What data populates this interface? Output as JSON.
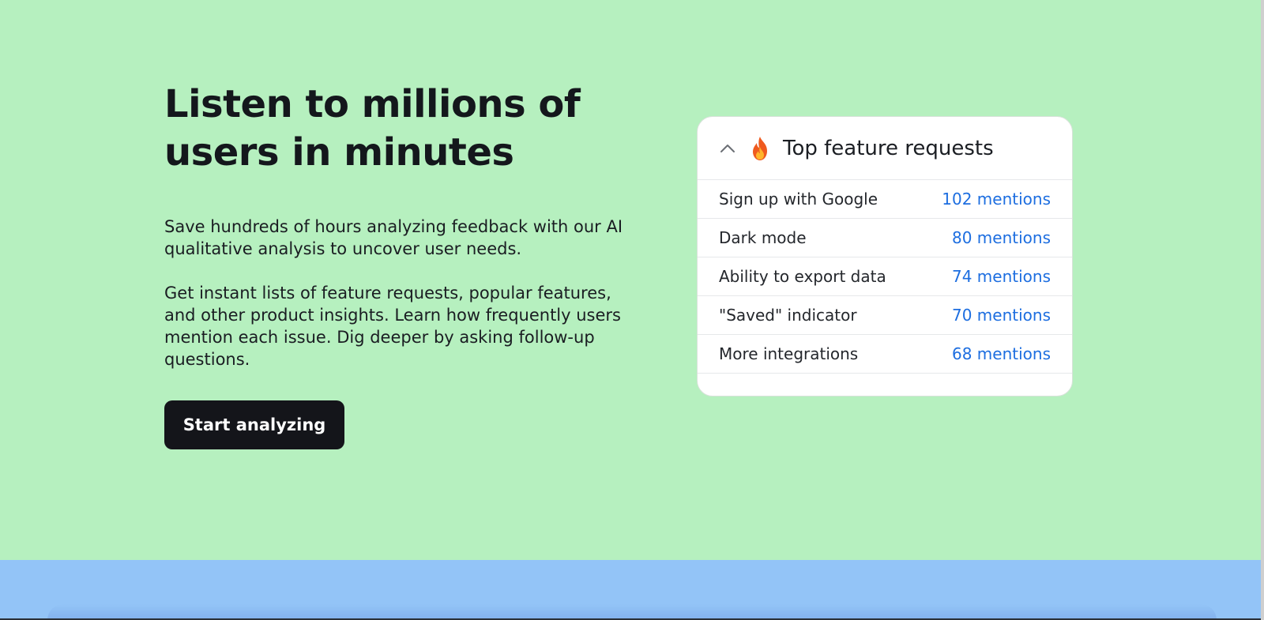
{
  "hero": {
    "headline": "Listen to millions of users in minutes",
    "paragraph_1": "Save hundreds of hours analyzing feedback with our AI qualitative analysis to uncover user needs.",
    "paragraph_2": "Get instant lists of feature requests, popular features, and other product insights. Learn how frequently users mention each issue. Dig deeper by asking follow-up questions.",
    "cta_label": "Start analyzing"
  },
  "card": {
    "title": "Top feature requests",
    "collapse_icon": "chevron-up-icon",
    "title_icon": "fire-icon",
    "rows": [
      {
        "label": "Sign up with Google",
        "count": "102 mentions"
      },
      {
        "label": "Dark mode",
        "count": "80 mentions"
      },
      {
        "label": "Ability to export data",
        "count": "74 mentions"
      },
      {
        "label": "\"Saved\" indicator",
        "count": "70 mentions"
      },
      {
        "label": "More integrations",
        "count": "68 mentions"
      }
    ]
  },
  "colors": {
    "hero_background": "#b6f0bf",
    "footer_background": "#93c4f7",
    "button_background": "#14151a",
    "mention_link": "#1d6ee0"
  }
}
